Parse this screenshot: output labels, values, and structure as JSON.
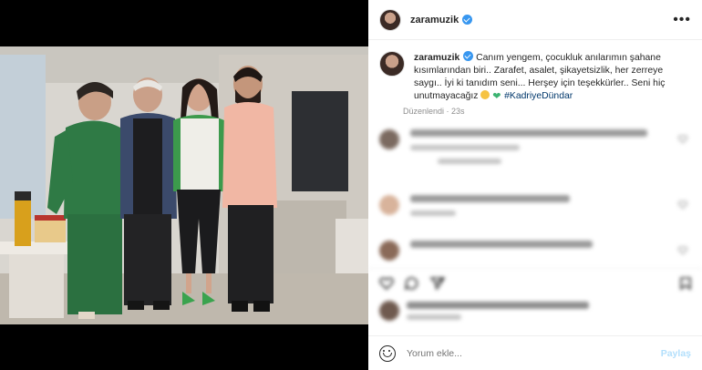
{
  "post": {
    "username": "zaramuzik",
    "more_label": "•••",
    "caption_text": "Canım yengem, çocukluk anılarımın şahane kısımlarından biri.. Zarafet, asalet, şikayetsizlik, her zerreye saygı.. İyi ki tanıdım seni... Herşey için teşekkürler.. Seni hiç unutmayacağız",
    "hashtag": "#KadriyeDündar",
    "edited": "Düzenlendi · 23s"
  },
  "composer": {
    "placeholder": "Yorum ekle...",
    "post_label": "Paylaş"
  },
  "colors": {
    "verified": "#3897f0",
    "hashtag": "#00376b",
    "post_disabled": "#b2dffc"
  },
  "icons": [
    "verified-icon",
    "more-icon",
    "heart-icon",
    "comment-icon",
    "share-icon",
    "bookmark-icon",
    "emoji-icon"
  ]
}
